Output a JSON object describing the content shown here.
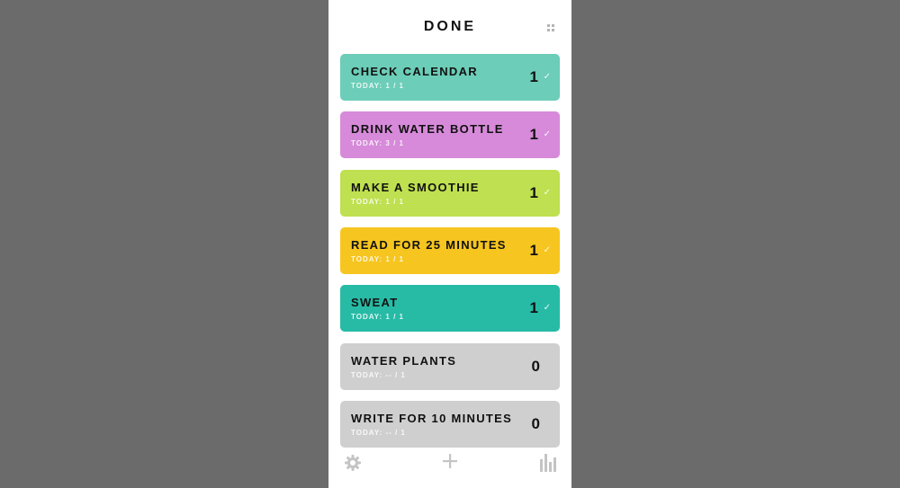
{
  "header": {
    "title": "DONE",
    "menu_icon": "grid-icon"
  },
  "habits": [
    {
      "name": "CHECK CALENDAR",
      "subtitle": "TODAY: 1 / 1",
      "count": "1",
      "done": true,
      "color": "#6ccdb8"
    },
    {
      "name": "DRINK WATER BOTTLE",
      "subtitle": "TODAY: 3 / 1",
      "count": "1",
      "done": true,
      "color": "#d68ad9"
    },
    {
      "name": "MAKE A SMOOTHIE",
      "subtitle": "TODAY: 1 / 1",
      "count": "1",
      "done": true,
      "color": "#bfe050"
    },
    {
      "name": "READ FOR 25 MINUTES",
      "subtitle": "TODAY: 1 / 1",
      "count": "1",
      "done": true,
      "color": "#f6c520"
    },
    {
      "name": "SWEAT",
      "subtitle": "TODAY: 1 / 1",
      "count": "1",
      "done": true,
      "color": "#27bba6"
    },
    {
      "name": "WATER PLANTS",
      "subtitle": "TODAY: -- / 1",
      "count": "0",
      "done": false,
      "color": "#cfcfcf"
    },
    {
      "name": "WRITE FOR 10 MINUTES",
      "subtitle": "TODAY: -- / 1",
      "count": "0",
      "done": false,
      "color": "#cfcfcf"
    }
  ],
  "check_glyph": "✓",
  "toolbar": {
    "settings_icon": "gear-icon",
    "add_icon": "plus-icon",
    "stats_icon": "bar-chart-icon"
  }
}
